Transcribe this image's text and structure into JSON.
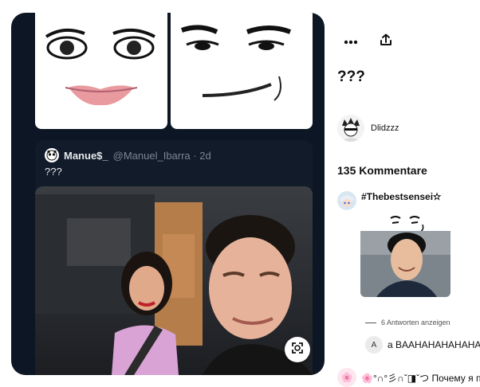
{
  "pin": {
    "tweet": {
      "name": "Manue$_",
      "handle": "@Manuel_Ibarra · 2d",
      "text": "???"
    }
  },
  "title": "???",
  "creator": {
    "name": "Dlidzzz"
  },
  "comments_count": "135 Kommentare",
  "comments": [
    {
      "author": "#Thebestsensei✫"
    }
  ],
  "replies_toggle": "6 Antworten anzeigen",
  "reply": {
    "avatar_letter": "A",
    "text": "a BAAHAHAHAHAHA"
  },
  "comment2": {
    "text": "🌸°∩°彡∩ˇ◨ˇつ Почему я пс"
  },
  "icons": {
    "more": "more-dots-icon",
    "share": "share-icon",
    "lens": "visual-search-icon"
  },
  "colors": {
    "card_bg": "#0d1624",
    "tweet_bg": "#111b2a"
  }
}
